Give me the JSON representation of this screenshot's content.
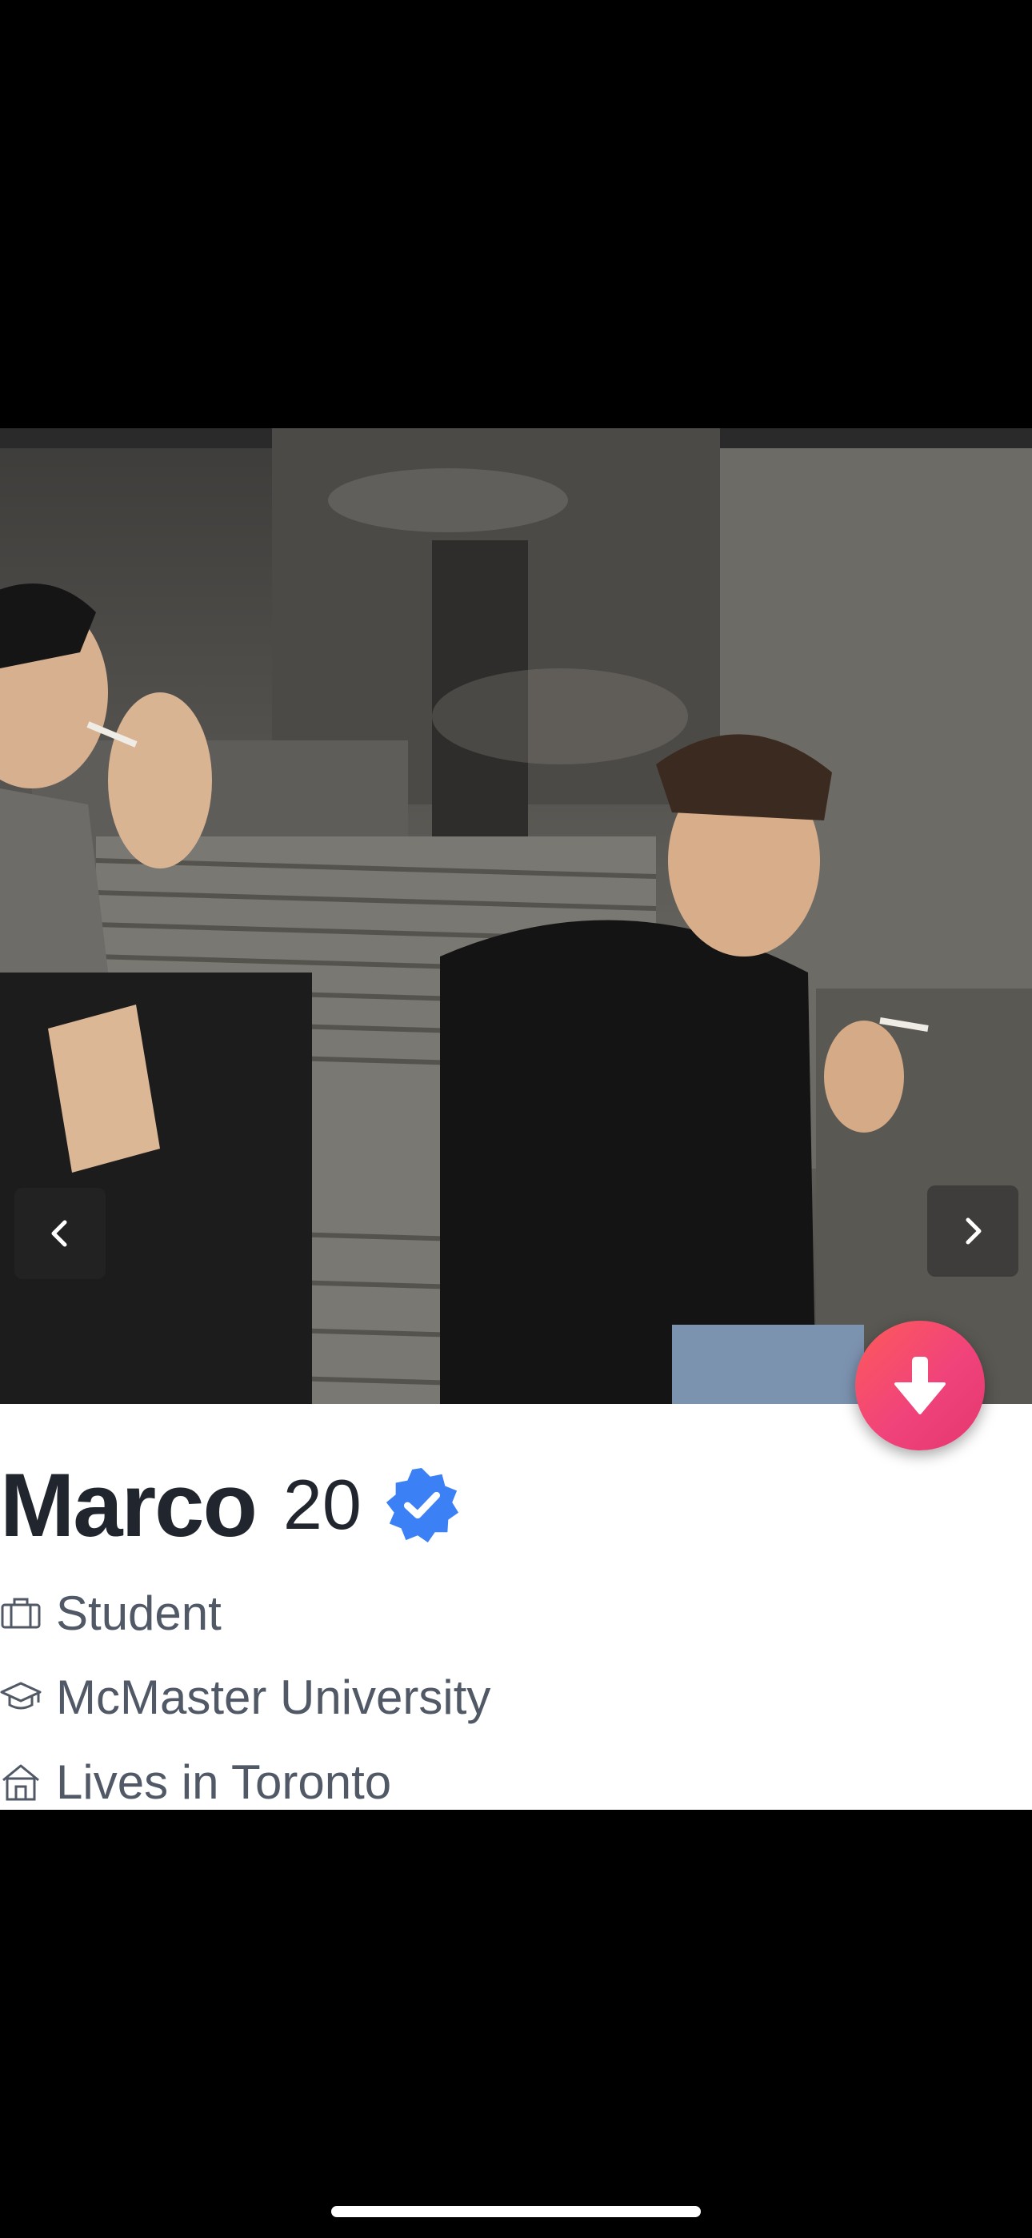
{
  "profile": {
    "name": "Marco",
    "age": "20",
    "verified": true,
    "details": [
      {
        "icon": "briefcase-icon",
        "text": "Student"
      },
      {
        "icon": "graduation-cap-icon",
        "text": "McMaster University"
      },
      {
        "icon": "home-icon",
        "text": "Lives in Toronto"
      }
    ]
  },
  "photo": {
    "description": "Two young men sitting on concrete steps at night, smoking"
  },
  "colors": {
    "verified_badge": "#3b80f5",
    "action_button": "#f0437b",
    "name_text": "#21262e",
    "detail_text": "#505965"
  },
  "icons": {
    "prev": "chevron-left-icon",
    "next": "chevron-right-icon",
    "collapse": "arrow-down-icon"
  }
}
